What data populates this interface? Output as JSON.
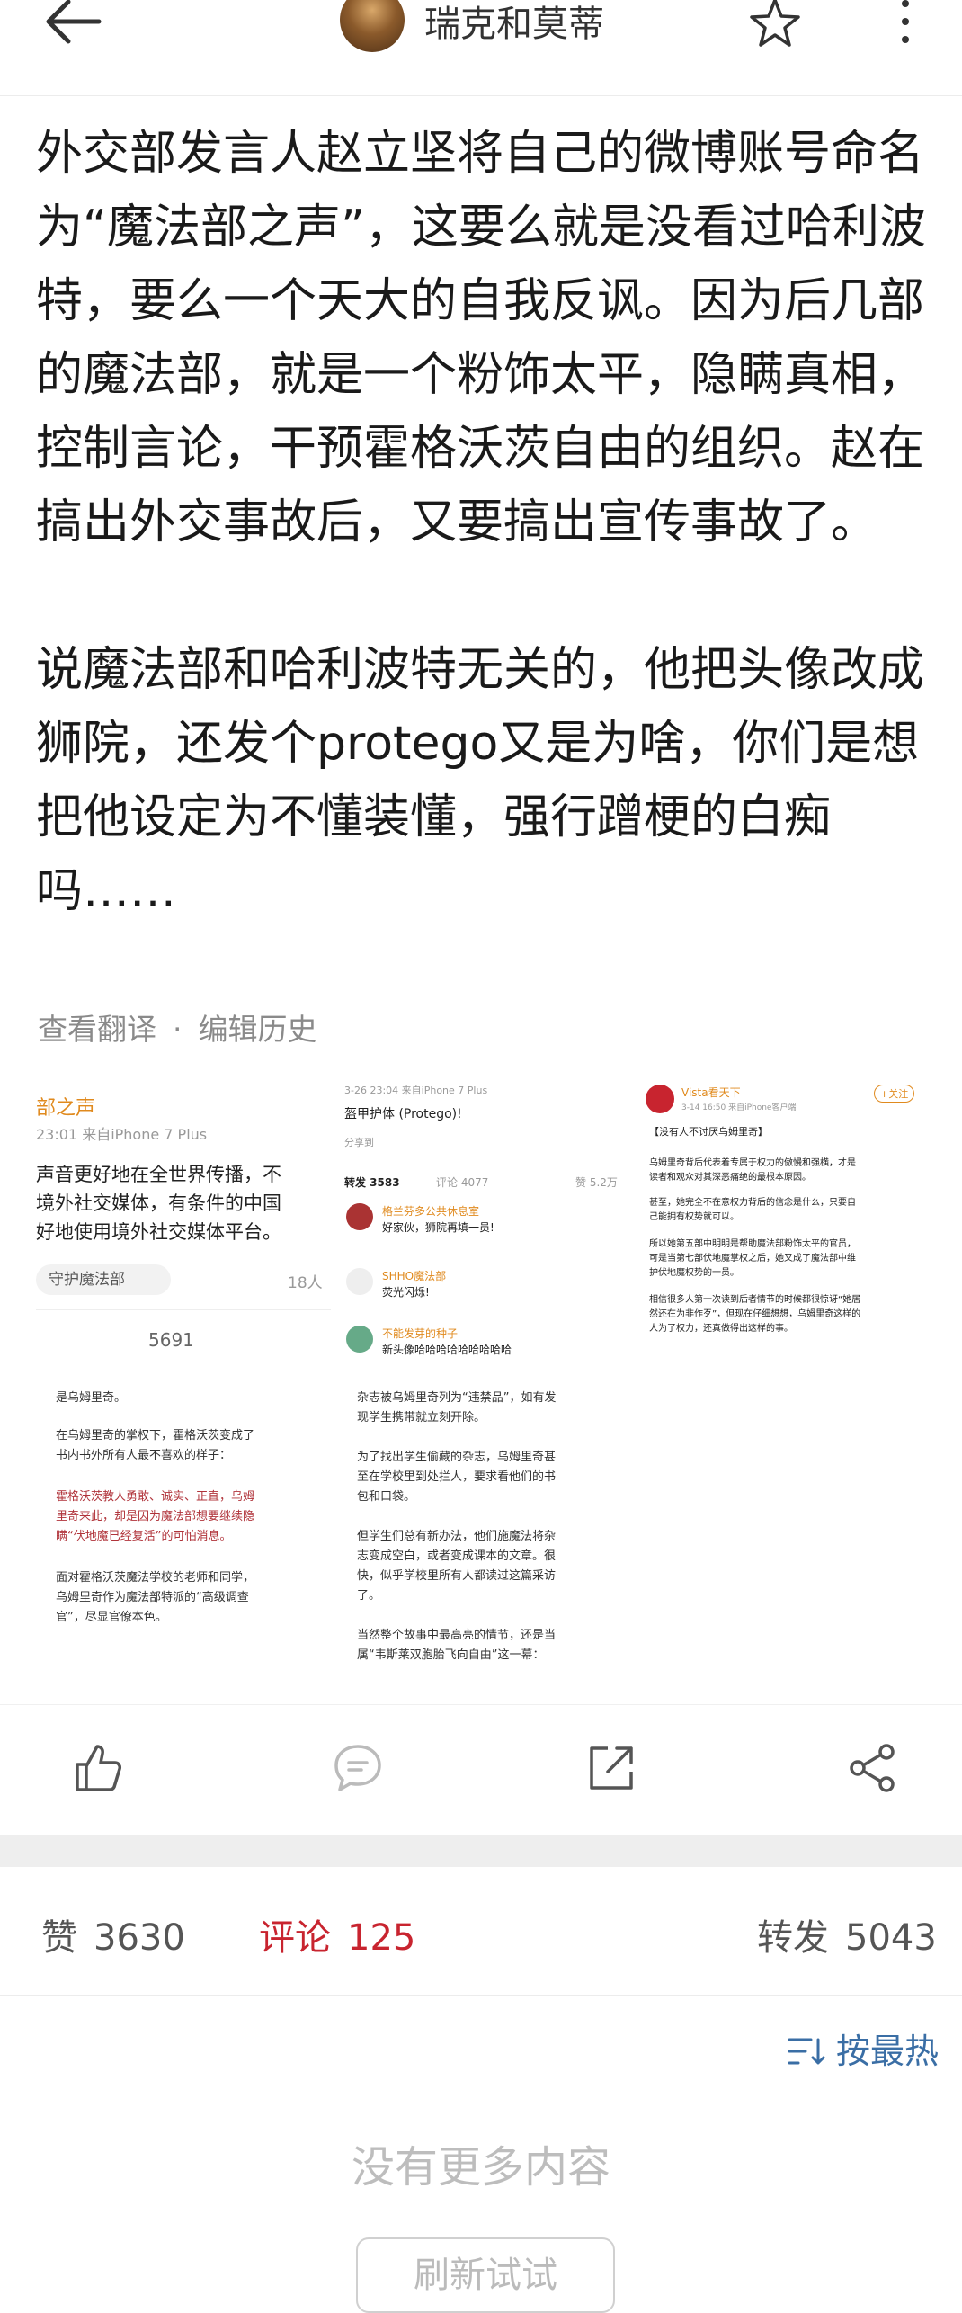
{
  "header": {
    "user_name": "瑞克和莫蒂",
    "back_icon": "back-arrow-icon",
    "star_icon": "star-icon",
    "more_icon": "more-vertical-icon"
  },
  "post": {
    "paragraphs": [
      "外交部发言人赵立坚将自己的微博账号命名为“魔法部之声”，这要么就是没看过哈利波特，要么一个天大的自我反讽。因为后几部的魔法部，就是一个粉饰太平，隐瞒真相，控制言论，干预霍格沃茨自由的组织。赵在搞出外交事故后，又要搞出宣传事故了。",
      "说魔法部和哈利波特无关的，他把头像改成狮院，还发个protego又是为啥，你们是想把他设定为不懂装懂，强行蹭梗的白痴吗……"
    ],
    "translate_label": "查看翻译",
    "separator": "·",
    "edit_history_label": "编辑历史"
  },
  "images": {
    "img1": {
      "l1": "部之声",
      "l2": "23:01 来自iPhone 7 Plus",
      "l3": "声音更好地在全世界传播，不",
      "l4": "境外社交媒体，有条件的中国",
      "l5": "好地使用境外社交媒体平台。",
      "l6": "守护魔法部",
      "l7": "18人",
      "l8": "5691"
    },
    "img2": {
      "l1": "3-26 23:04 来自iPhone 7 Plus",
      "l2": "盔甲护体 (Protego)!",
      "l3": "分享到",
      "l4": "转发 3583",
      "l5": "评论 4077",
      "l6": "赞 5.2万",
      "l7": "格兰芬多公共休息室",
      "l8": "好家伙，狮院再填一员!",
      "l9": "SHHO魔法部",
      "l10": "荧光闪烁!",
      "l11": "不能发芽的种子",
      "l12": "新头像哈哈哈哈哈哈哈哈哈"
    },
    "img3": {
      "l1": "Vista看天下",
      "l2": "+关注",
      "l3": "3-14 16:50 来自iPhone客户端",
      "l4": "【没有人不讨厌乌姆里奇】",
      "l5": "乌姆里奇背后代表着专属于权力的傲慢和强横，才是",
      "l6": "读者和观众对其深恶痛绝的最根本原因。",
      "l7": "甚至，她完全不在意权力背后的信念是什么，只要自",
      "l8": "己能拥有权势就可以。",
      "l9": "所以她第五部中明明是帮助魔法部粉饰太平的官员，",
      "l10": "可是当第七部伏地魔掌权之后，她又成了魔法部中维",
      "l11": "护伏地魔权势的一员。",
      "l12": "相信很多人第一次读到后者情节的时候都很惊讶“她居",
      "l13": "然还在为非作歹”，但现在仔细想想，乌姆里奇这样的",
      "l14": "人为了权力，还真做得出这样的事。"
    },
    "img4": {
      "l1": "是乌姆里奇。",
      "l2": "在乌姆里奇的掌权下，霍格沃茨变成了",
      "l3": "书内书外所有人最不喜欢的样子：",
      "l4": "霍格沃茨教人勇敢、诚实、正直，乌姆",
      "l5": "里奇来此，却是因为魔法部想要继续隐",
      "l6": "瞒“伏地魔已经复活”的可怕消息。",
      "l7": "面对霍格沃茨魔法学校的老师和同学，",
      "l8": "乌姆里奇作为魔法部特派的“高级调查",
      "l9": "官”，尽显官僚本色。"
    },
    "img5": {
      "l1": "杂志被乌姆里奇列为“违禁品”，如有发",
      "l2": "现学生携带就立刻开除。",
      "l3": "为了找出学生偷藏的杂志，乌姆里奇甚",
      "l4": "至在学校里到处拦人，要求看他们的书",
      "l5": "包和口袋。",
      "l6": "但学生们总有新办法，他们施魔法将杂",
      "l7": "志变成空白，或者变成课本的文章。很",
      "l8": "快，似乎学校里所有人都读过这篇采访",
      "l9": "了。",
      "l10": "当然整个故事中最高亮的情节，还是当",
      "l11": "属“韦斯莱双胞胎飞向自由”这一幕："
    }
  },
  "action_bar": {
    "like_icon": "thumbs-up-icon",
    "comment_icon": "comment-icon",
    "repost_icon": "repost-icon",
    "share_icon": "share-icon"
  },
  "stats": {
    "likes_label": "赞",
    "likes_count": "3630",
    "comments_label": "评论",
    "comments_count": "125",
    "reposts_label": "转发",
    "reposts_count": "5043"
  },
  "sort": {
    "label": "按最热",
    "icon": "sort-icon"
  },
  "no_more_label": "没有更多内容",
  "refresh_label": "刷新试试",
  "colors": {
    "accent_red": "#c8242f",
    "link_blue": "#3a6ea5",
    "band_gray": "#eeeeee"
  }
}
